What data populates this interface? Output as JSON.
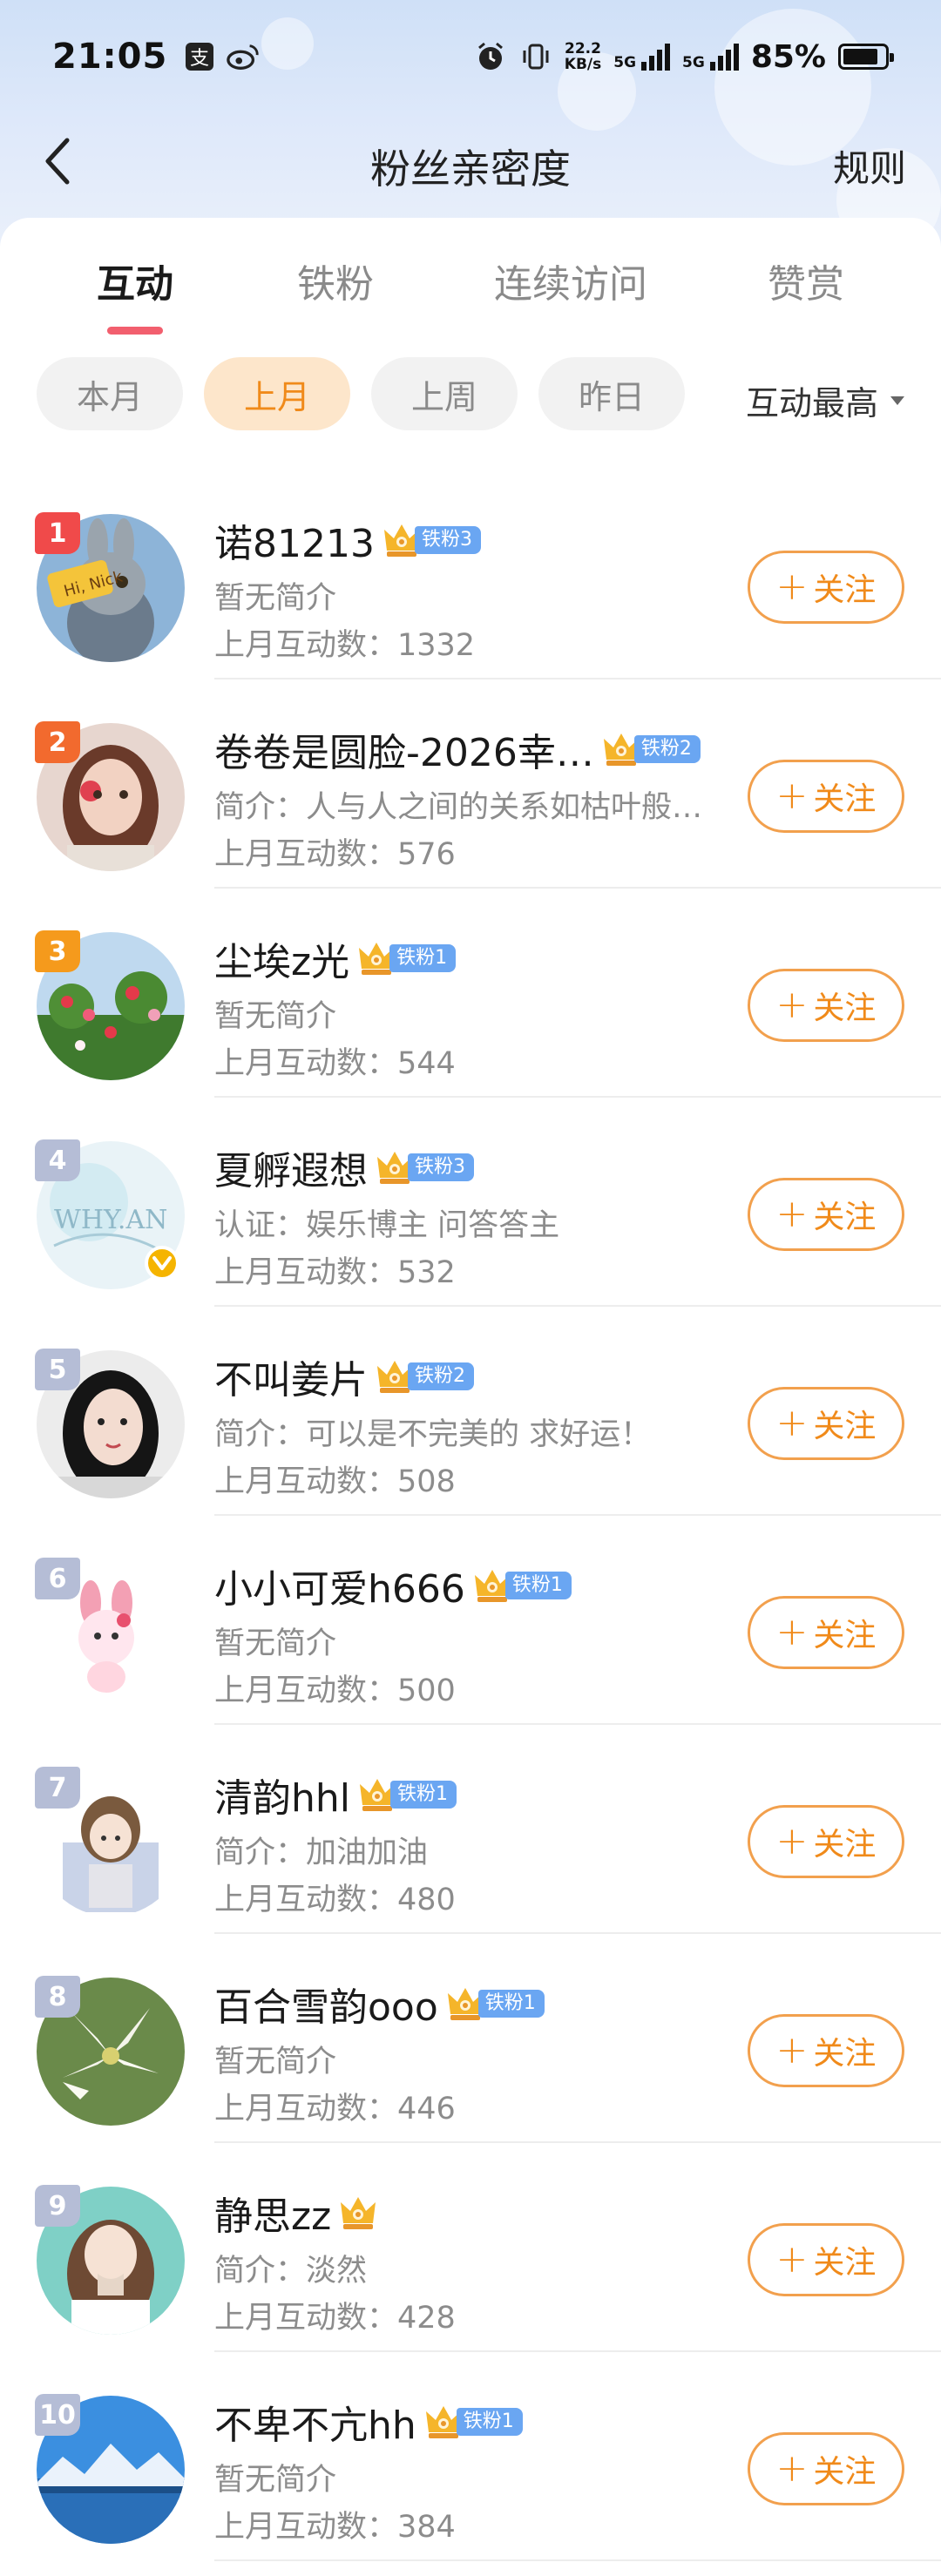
{
  "status_bar": {
    "time": "21:05",
    "net_speed_value": "22.2",
    "net_speed_unit": "KB/s",
    "sim1_label": "5G",
    "sim2_label": "5G",
    "battery": "85%",
    "battery_level": 0.85
  },
  "nav": {
    "title": "粉丝亲密度",
    "rules": "规则",
    "back_icon": "chevron-left-icon"
  },
  "tabs": [
    {
      "label": "互动",
      "active": true
    },
    {
      "label": "铁粉",
      "active": false
    },
    {
      "label": "连续访问",
      "active": false
    },
    {
      "label": "赞赏",
      "active": false
    }
  ],
  "filters": [
    {
      "label": "本月",
      "active": false
    },
    {
      "label": "上月",
      "active": true
    },
    {
      "label": "上周",
      "active": false
    },
    {
      "label": "昨日",
      "active": false
    }
  ],
  "sort": {
    "label": "互动最高"
  },
  "colors": {
    "accent": "#f08a1a",
    "tab_indicator": "#f25f6e",
    "rank_1": "#f04a4a",
    "rank_2": "#f26a2e",
    "rank_3": "#f59a1c",
    "rank_other": "#b5bdd6",
    "fan_tag": "#6aa6f2"
  },
  "follow_label": "关注",
  "fans": [
    {
      "rank": "1",
      "name": "诺81213",
      "badge": "铁粉3",
      "desc": "暂无简介",
      "count": "上月互动数：1332",
      "verified": false
    },
    {
      "rank": "2",
      "name": "卷卷是圆脸-2026幸…",
      "badge": "铁粉2",
      "desc": "简介：人与人之间的关系如枯叶般…",
      "count": "上月互动数：576",
      "verified": false
    },
    {
      "rank": "3",
      "name": "尘埃z光",
      "badge": "铁粉1",
      "desc": "暂无简介",
      "count": "上月互动数：544",
      "verified": false
    },
    {
      "rank": "4",
      "name": "夏孵遐想",
      "badge": "铁粉3",
      "desc": "认证：娱乐博主 问答答主",
      "count": "上月互动数：532",
      "verified": true
    },
    {
      "rank": "5",
      "name": "不叫姜片",
      "badge": "铁粉2",
      "desc": "简介：可以是不完美的 求好运！",
      "count": "上月互动数：508",
      "verified": false
    },
    {
      "rank": "6",
      "name": "小小可爱h666",
      "badge": "铁粉1",
      "desc": "暂无简介",
      "count": "上月互动数：500",
      "verified": false
    },
    {
      "rank": "7",
      "name": "清韵hhl",
      "badge": "铁粉1",
      "desc": "简介：加油加油",
      "count": "上月互动数：480",
      "verified": false
    },
    {
      "rank": "8",
      "name": "百合雪韵ooo",
      "badge": "铁粉1",
      "desc": "暂无简介",
      "count": "上月互动数：446",
      "verified": false
    },
    {
      "rank": "9",
      "name": "静思zz",
      "badge": "",
      "desc": "简介：淡然",
      "count": "上月互动数：428",
      "verified": false
    },
    {
      "rank": "10",
      "name": "不卑不亢hh",
      "badge": "铁粉1",
      "desc": "暂无简介",
      "count": "上月互动数：384",
      "verified": false
    }
  ]
}
